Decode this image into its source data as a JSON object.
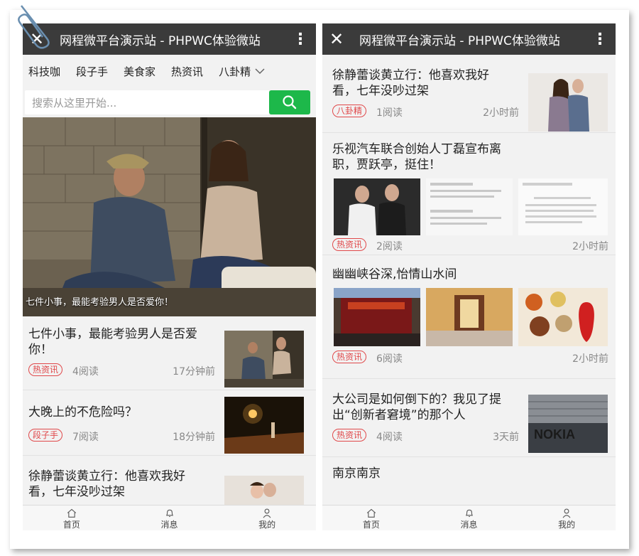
{
  "app": {
    "title": "网程微平台演示站 - PHPWC体验微站",
    "close_glyph": "✕",
    "more_glyph": "⋮"
  },
  "left": {
    "categories": [
      "科技咖",
      "段子手",
      "美食家",
      "热资讯",
      "八卦精"
    ],
    "search_placeholder": "搜索从这里开始...",
    "hero_caption": "七件小事，最能考验男人是否爱你！",
    "items": [
      {
        "title": "七件小事，最能考验男人是否爱你！",
        "tag": "热资讯",
        "reads": "4阅读",
        "time": "17分钟前"
      },
      {
        "title": "大晚上的不危险吗？",
        "tag": "段子手",
        "reads": "7阅读",
        "time": "18分钟前"
      },
      {
        "title": "徐静蕾谈黄立行：他喜欢我好看，七年没吵过架"
      }
    ]
  },
  "right": {
    "items": [
      {
        "title": "徐静蕾谈黄立行：他喜欢我好看，七年没吵过架",
        "tag": "八卦精",
        "reads": "1阅读",
        "time": "2小时前"
      },
      {
        "title": "乐视汽车联合创始人丁磊宣布离职，贾跃亭，挺住！",
        "tag": "热资讯",
        "reads": "2阅读",
        "time": "2小时前"
      },
      {
        "title": "幽幽峡谷深,怡情山水间",
        "tag": "热资讯",
        "reads": "6阅读",
        "time": "2小时前"
      },
      {
        "title": "大公司是如何倒下的？我见了提出“创新者窘境”的那个人",
        "tag": "热资讯",
        "reads": "4阅读",
        "time": "3天前"
      },
      {
        "title": "南京南京"
      }
    ]
  },
  "tabbar": {
    "home": "首页",
    "messages": "消息",
    "mine": "我的"
  },
  "colors": {
    "titlebar": "#3b3b3b",
    "accent_green": "#1db84a",
    "tag_red": "#e0484a"
  }
}
